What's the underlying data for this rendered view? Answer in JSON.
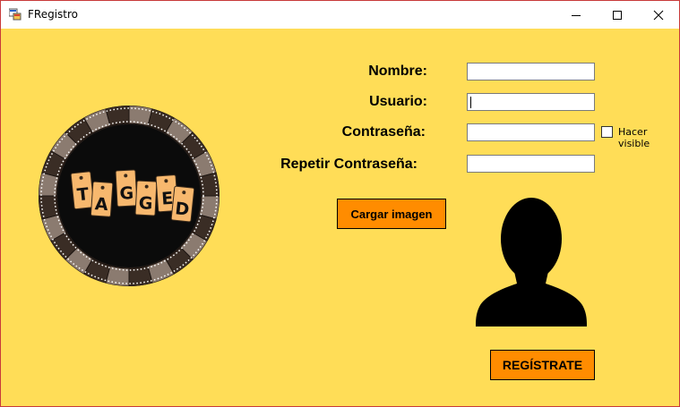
{
  "window": {
    "title": "FRegistro",
    "accent_border": "#c83a3a",
    "background": "#ffdd57"
  },
  "form": {
    "nombre_label": "Nombre:",
    "usuario_label": "Usuario:",
    "contrasena_label": "Contraseña:",
    "repetir_label": "Repetir Contraseña:",
    "nombre_value": "",
    "usuario_value": "",
    "contrasena_value": "",
    "repetir_value": "",
    "hacer_visible_label": "Hacer visible",
    "hacer_visible_checked": false
  },
  "buttons": {
    "cargar_imagen": "Cargar imagen",
    "registrate": "REGÍSTRATE",
    "color": "#ff8c00"
  },
  "logo": {
    "letters": [
      "T",
      "A",
      "G",
      "G",
      "E",
      "D"
    ]
  },
  "icons": [
    "app-icon",
    "minimize-icon",
    "maximize-icon",
    "close-icon",
    "avatar-silhouette-icon"
  ]
}
